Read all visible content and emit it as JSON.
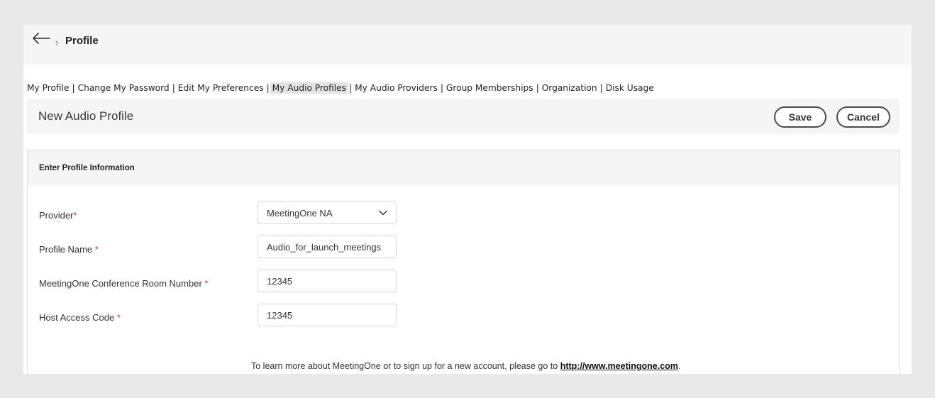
{
  "header": {
    "breadcrumb_sep": "›",
    "title": "Profile"
  },
  "subnav": {
    "items": [
      {
        "label": "My Profile"
      },
      {
        "label": "Change My Password"
      },
      {
        "label": "Edit My Preferences"
      },
      {
        "label": "My Audio Profiles",
        "active": true
      },
      {
        "label": "My Audio Providers"
      },
      {
        "label": "Group Memberships"
      },
      {
        "label": "Organization"
      },
      {
        "label": "Disk Usage"
      }
    ],
    "separator": "|"
  },
  "titlebar": {
    "title": "New Audio Profile",
    "save_label": "Save",
    "cancel_label": "Cancel"
  },
  "form": {
    "section_title": "Enter Profile Information",
    "required_mark": "*",
    "provider": {
      "label": "Provider",
      "value": "MeetingOne NA"
    },
    "profile_name": {
      "label": "Profile Name",
      "value": "Audio_for_launch_meetings"
    },
    "room_number": {
      "label": "MeetingOne Conference Room Number",
      "value": "12345"
    },
    "host_code": {
      "label": "Host Access Code",
      "value": "12345"
    }
  },
  "footer": {
    "text": "To learn more about MeetingOne or to sign up for a new account, please go to ",
    "link": "http://www.meetingone.com",
    "end": "."
  },
  "colors": {
    "background": "#e9e9e9",
    "panel": "#f5f5f5",
    "required": "#d7373f",
    "active_tab": "#e3e3e3"
  }
}
